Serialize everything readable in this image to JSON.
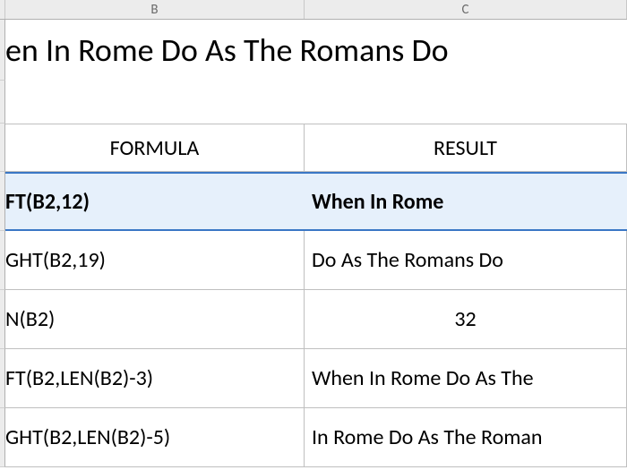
{
  "columns": {
    "B": "B",
    "C": "C"
  },
  "title": "en In Rome Do As The Romans Do",
  "headers": {
    "formula": "FORMULA",
    "result": "RESULT"
  },
  "rows": [
    {
      "formula": "FT(B2,12)",
      "result": "When In Rome",
      "result_align": "left"
    },
    {
      "formula": "GHT(B2,19)",
      "result": "Do As The Romans Do",
      "result_align": "left"
    },
    {
      "formula": "N(B2)",
      "result": "32",
      "result_align": "center"
    },
    {
      "formula": "FT(B2,LEN(B2)-3)",
      "result": "When In Rome Do As The",
      "result_align": "left"
    },
    {
      "formula": "GHT(B2,LEN(B2)-5)",
      "result": "In Rome Do As The Roman",
      "result_align": "left"
    }
  ],
  "selected_row_index": 0
}
